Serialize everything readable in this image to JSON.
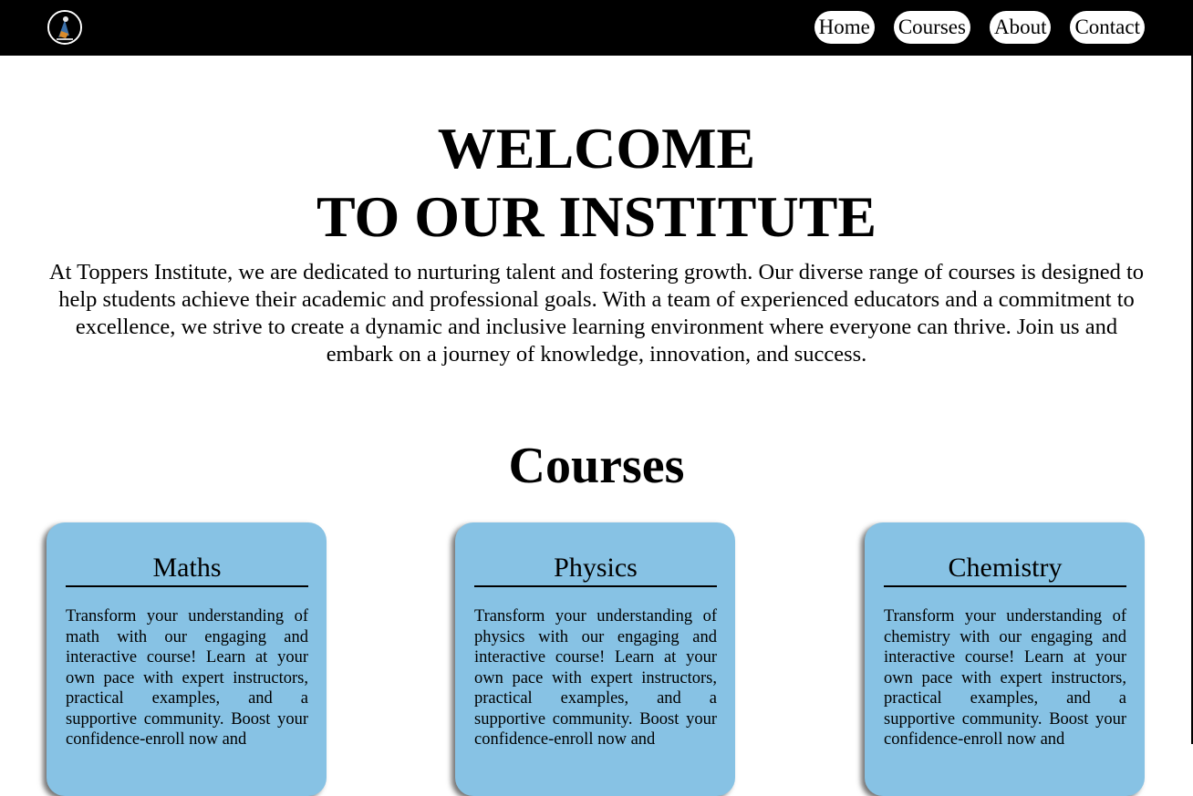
{
  "nav": {
    "links": [
      "Home",
      "Courses",
      "About",
      "Contact"
    ]
  },
  "hero": {
    "title_line1": "WELCOME",
    "title_line2": "TO OUR INSTITUTE",
    "text": "At Toppers Institute, we are dedicated to nurturing talent and fostering growth. Our diverse range of courses is designed to help students achieve their academic and professional goals. With a team of experienced educators and a commitment to excellence, we strive to create a dynamic and inclusive learning environment where everyone can thrive. Join us and embark on a journey of knowledge, innovation, and success."
  },
  "courses": {
    "heading": "Courses",
    "cards": [
      {
        "title": "Maths",
        "text": "Transform your understanding of math with our engaging and interactive course! Learn at your own pace with expert instructors, practical examples, and a supportive community. Boost your confidence-enroll now and"
      },
      {
        "title": "Physics",
        "text": "Transform your understanding of physics with our engaging and interactive course! Learn at your own pace with expert instructors, practical examples, and a supportive community. Boost your confidence-enroll now and"
      },
      {
        "title": "Chemistry",
        "text": "Transform your understanding of chemistry with our engaging and interactive course! Learn at your own pace with expert instructors, practical examples, and a supportive community. Boost your confidence-enroll now and"
      }
    ]
  },
  "colors": {
    "navbar_bg": "#000000",
    "card_bg": "#87c2e4",
    "nav_pill_bg": "#ffffff"
  },
  "icons": {
    "logo": "graduate-logo-icon"
  }
}
